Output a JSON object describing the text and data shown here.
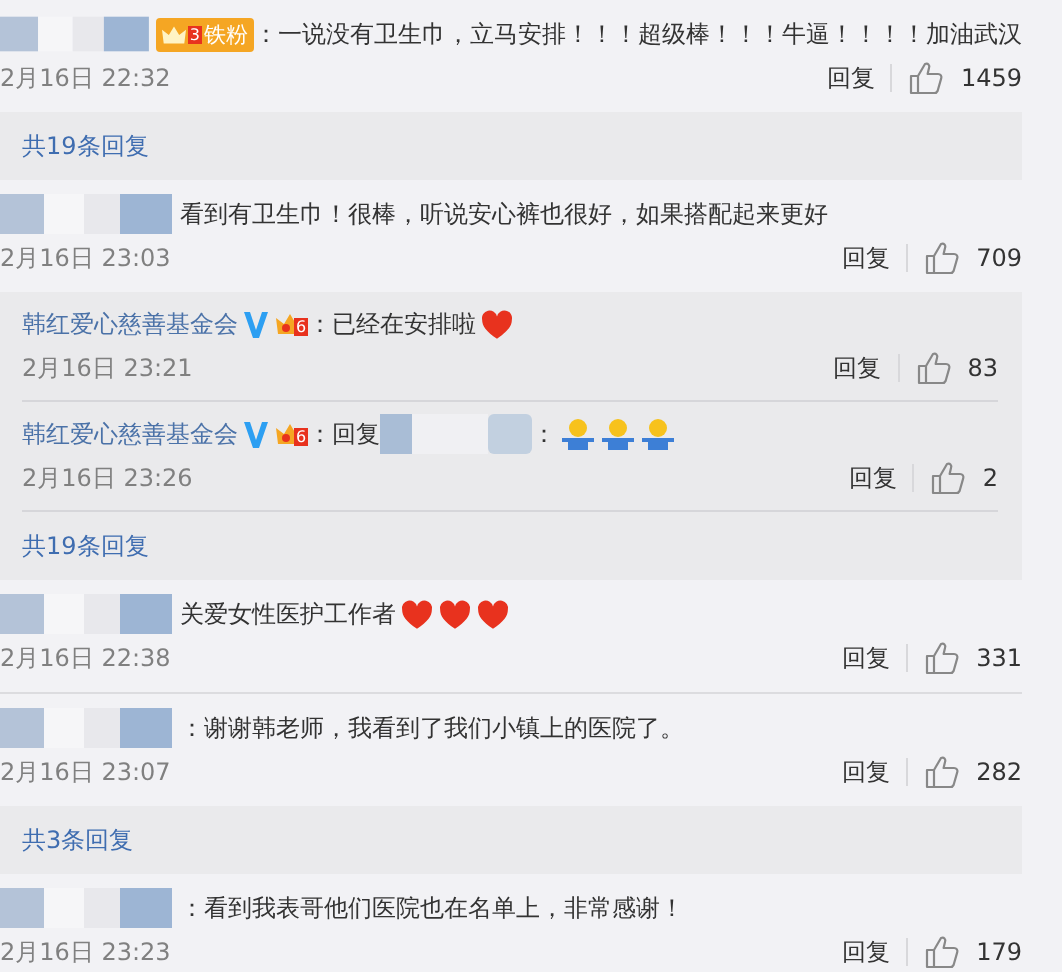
{
  "comments": [
    {
      "segments": [
        {
          "kind": "redacted"
        },
        {
          "kind": "fan_badge",
          "level": "3",
          "label": "铁粉"
        },
        {
          "kind": "text",
          "text": "：一说没有卫生巾，立马安排！！！超级棒！！！牛逼！！！！加油武汉"
        }
      ],
      "time": "2月16日 22:32",
      "reply_label": "回复",
      "likes": "1459",
      "more_replies": "共19条回复"
    },
    {
      "segments": [
        {
          "kind": "redacted"
        },
        {
          "kind": "text",
          "text": "看到有卫生巾！很棒，听说安心裤也很好，如果搭配起来更好"
        }
      ],
      "time": "2月16日 23:03",
      "reply_label": "回复",
      "likes": "709",
      "more_replies": "共19条回复",
      "replies": [
        {
          "segments": [
            {
              "kind": "name",
              "text": "韩红爱心慈善基金会"
            },
            {
              "kind": "verified"
            },
            {
              "kind": "crown",
              "level": "6"
            },
            {
              "kind": "text",
              "text": "：已经在安排啦"
            },
            {
              "kind": "heart"
            }
          ],
          "time": "2月16日 23:21",
          "reply_label": "回复",
          "likes": "83"
        },
        {
          "segments": [
            {
              "kind": "name",
              "text": "韩红爱心慈善基金会"
            },
            {
              "kind": "verified"
            },
            {
              "kind": "crown",
              "level": "6"
            },
            {
              "kind": "text",
              "text": "：回复"
            },
            {
              "kind": "redacted"
            },
            {
              "kind": "text",
              "text": "："
            },
            {
              "kind": "figure"
            },
            {
              "kind": "figure"
            },
            {
              "kind": "figure"
            }
          ],
          "time": "2月16日 23:26",
          "reply_label": "回复",
          "likes": "2"
        }
      ]
    },
    {
      "segments": [
        {
          "kind": "redacted"
        },
        {
          "kind": "text",
          "text": "关爱女性医护工作者"
        },
        {
          "kind": "heart"
        },
        {
          "kind": "heart"
        },
        {
          "kind": "heart"
        }
      ],
      "time": "2月16日 22:38",
      "reply_label": "回复",
      "likes": "331"
    },
    {
      "segments": [
        {
          "kind": "redacted"
        },
        {
          "kind": "text",
          "text": "：谢谢韩老师，我看到了我们小镇上的医院了。"
        }
      ],
      "time": "2月16日 23:07",
      "reply_label": "回复",
      "likes": "282",
      "more_replies": "共3条回复"
    },
    {
      "segments": [
        {
          "kind": "redacted"
        },
        {
          "kind": "text",
          "text": "：看到我表哥他们医院也在名单上，非常感谢！"
        }
      ],
      "time": "2月16日 23:23",
      "reply_label": "回复",
      "likes": "179"
    }
  ]
}
